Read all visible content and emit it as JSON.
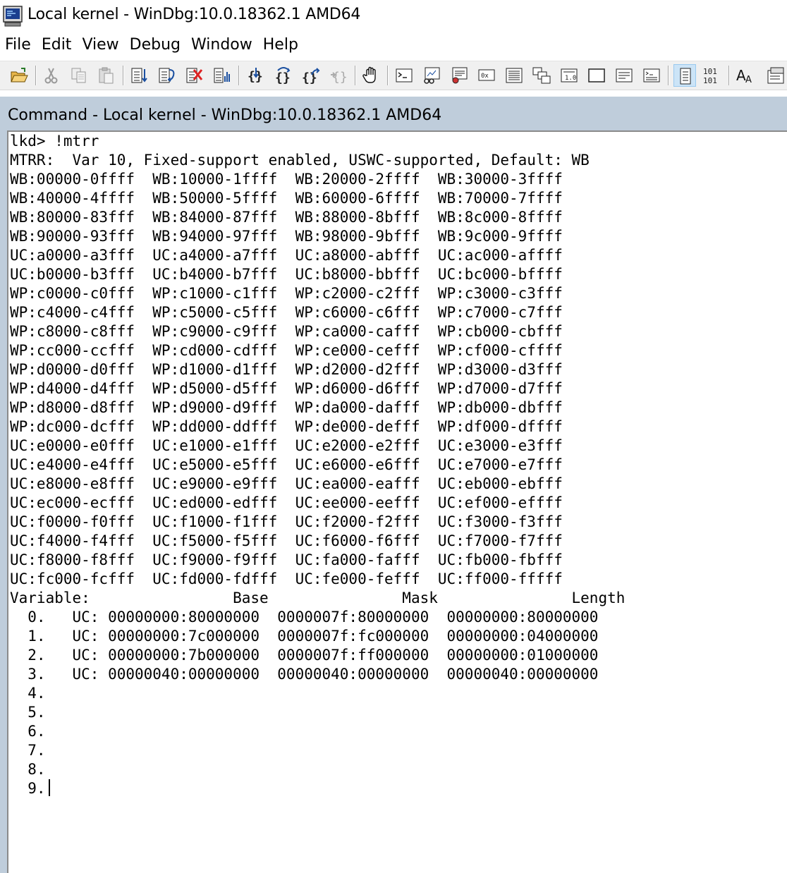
{
  "window": {
    "title": "Local kernel - WinDbg:10.0.18362.1 AMD64"
  },
  "menu": [
    "File",
    "Edit",
    "View",
    "Debug",
    "Window",
    "Help"
  ],
  "toolbar": {
    "buttons": [
      "open-icon",
      "cut-icon",
      "copy-icon",
      "paste-icon",
      "step-into-icon",
      "step-over-icon",
      "break-icon",
      "source-mode-icon",
      "step-in-brace-icon",
      "step-over-brace-icon",
      "step-out-brace-icon",
      "run-to-cursor-icon",
      "hand-icon",
      "command-icon",
      "watch-icon",
      "locals-icon",
      "registers-icon",
      "memory-icon",
      "call-stack-icon",
      "disassembly-icon",
      "scratch-pad-icon",
      "processes-icon",
      "command-browser-icon",
      "source-mode-toggle-icon",
      "hex-icon",
      "font-icon",
      "options-icon"
    ]
  },
  "command_window": {
    "title": "Command - Local kernel - WinDbg:10.0.18362.1 AMD64",
    "lines": [
      "lkd> !mtrr",
      "MTRR:  Var 10, Fixed-support enabled, USWC-supported, Default: WB",
      "WB:00000-0ffff  WB:10000-1ffff  WB:20000-2ffff  WB:30000-3ffff",
      "WB:40000-4ffff  WB:50000-5ffff  WB:60000-6ffff  WB:70000-7ffff",
      "WB:80000-83fff  WB:84000-87fff  WB:88000-8bfff  WB:8c000-8ffff",
      "WB:90000-93fff  WB:94000-97fff  WB:98000-9bfff  WB:9c000-9ffff",
      "UC:a0000-a3fff  UC:a4000-a7fff  UC:a8000-abfff  UC:ac000-affff",
      "UC:b0000-b3fff  UC:b4000-b7fff  UC:b8000-bbfff  UC:bc000-bffff",
      "WP:c0000-c0fff  WP:c1000-c1fff  WP:c2000-c2fff  WP:c3000-c3fff",
      "WP:c4000-c4fff  WP:c5000-c5fff  WP:c6000-c6fff  WP:c7000-c7fff",
      "WP:c8000-c8fff  WP:c9000-c9fff  WP:ca000-cafff  WP:cb000-cbfff",
      "WP:cc000-ccfff  WP:cd000-cdfff  WP:ce000-cefff  WP:cf000-cffff",
      "WP:d0000-d0fff  WP:d1000-d1fff  WP:d2000-d2fff  WP:d3000-d3fff",
      "WP:d4000-d4fff  WP:d5000-d5fff  WP:d6000-d6fff  WP:d7000-d7fff",
      "WP:d8000-d8fff  WP:d9000-d9fff  WP:da000-dafff  WP:db000-dbfff",
      "WP:dc000-dcfff  WP:dd000-ddfff  WP:de000-defff  WP:df000-dffff",
      "UC:e0000-e0fff  UC:e1000-e1fff  UC:e2000-e2fff  UC:e3000-e3fff",
      "UC:e4000-e4fff  UC:e5000-e5fff  UC:e6000-e6fff  UC:e7000-e7fff",
      "UC:e8000-e8fff  UC:e9000-e9fff  UC:ea000-eafff  UC:eb000-ebfff",
      "UC:ec000-ecfff  UC:ed000-edfff  UC:ee000-eefff  UC:ef000-effff",
      "UC:f0000-f0fff  UC:f1000-f1fff  UC:f2000-f2fff  UC:f3000-f3fff",
      "UC:f4000-f4fff  UC:f5000-f5fff  UC:f6000-f6fff  UC:f7000-f7fff",
      "UC:f8000-f8fff  UC:f9000-f9fff  UC:fa000-fafff  UC:fb000-fbfff",
      "UC:fc000-fcfff  UC:fd000-fdfff  UC:fe000-fefff  UC:ff000-fffff",
      "Variable:                Base               Mask               Length",
      "  0.   UC: 00000000:80000000  0000007f:80000000  00000000:80000000",
      "  1.   UC: 00000000:7c000000  0000007f:fc000000  00000000:04000000",
      "  2.   UC: 00000000:7b000000  0000007f:ff000000  00000000:01000000",
      "  3.   UC: 00000040:00000000  00000040:00000000  00000040:00000000",
      "  4.",
      "  5.",
      "  6.",
      "  7.",
      "  8.",
      "  9."
    ]
  }
}
